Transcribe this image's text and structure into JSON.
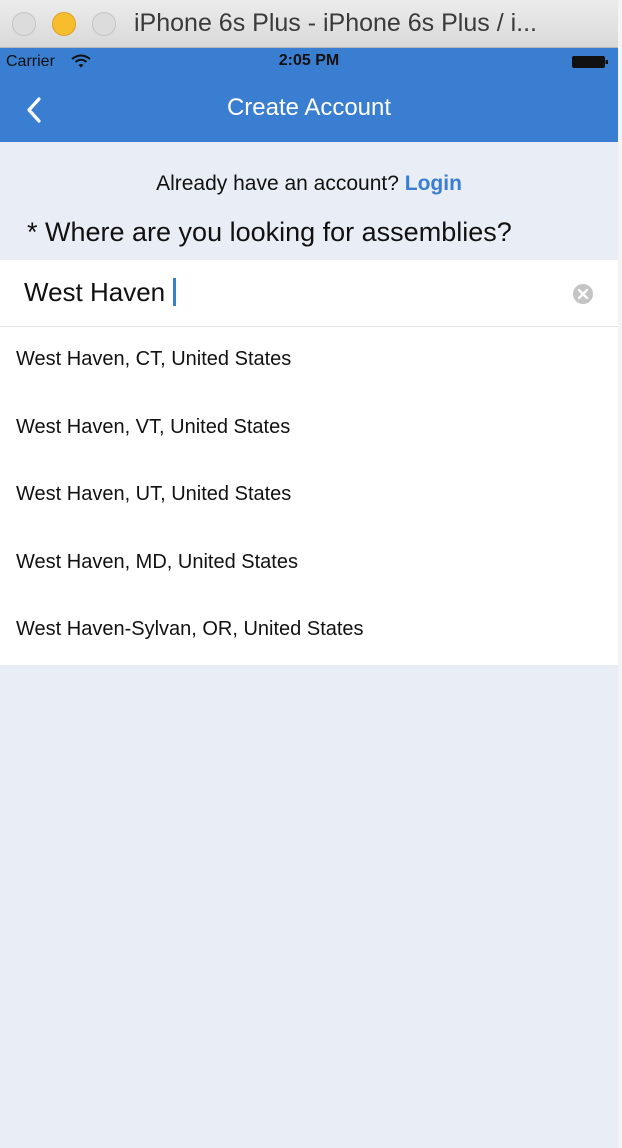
{
  "window": {
    "title": "iPhone 6s Plus - iPhone 6s Plus / i..."
  },
  "status_bar": {
    "carrier": "Carrier",
    "time": "2:05 PM"
  },
  "nav": {
    "title": "Create Account",
    "accent_color": "#3a7ed1"
  },
  "login_prompt": {
    "text": "Already have an account?",
    "link_label": "Login"
  },
  "question": "* Where are you looking for assemblies?",
  "search": {
    "value": "West Haven"
  },
  "results": [
    "West Haven, CT, United States",
    "West Haven, VT, United States",
    "West Haven, UT, United States",
    "West Haven, MD, United States",
    "West Haven-Sylvan, OR, United States"
  ]
}
